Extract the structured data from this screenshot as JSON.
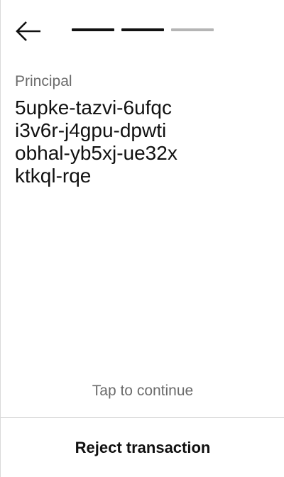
{
  "header": {
    "back_icon": "arrow-left-icon",
    "steps": [
      "done",
      "done",
      "todo"
    ]
  },
  "content": {
    "label": "Principal",
    "principal_lines": [
      "5upke-tazvi-6ufqc",
      "i3v6r-j4gpu-dpwti",
      "obhal-yb5xj-ue32x",
      "ktkql-rqe"
    ]
  },
  "footer": {
    "tap_hint": "Tap to continue",
    "reject_label": "Reject transaction"
  },
  "colors": {
    "text": "#111111",
    "muted": "#6b6b6b",
    "step_inactive": "#b5b5b5",
    "divider": "#d0d0d0"
  }
}
